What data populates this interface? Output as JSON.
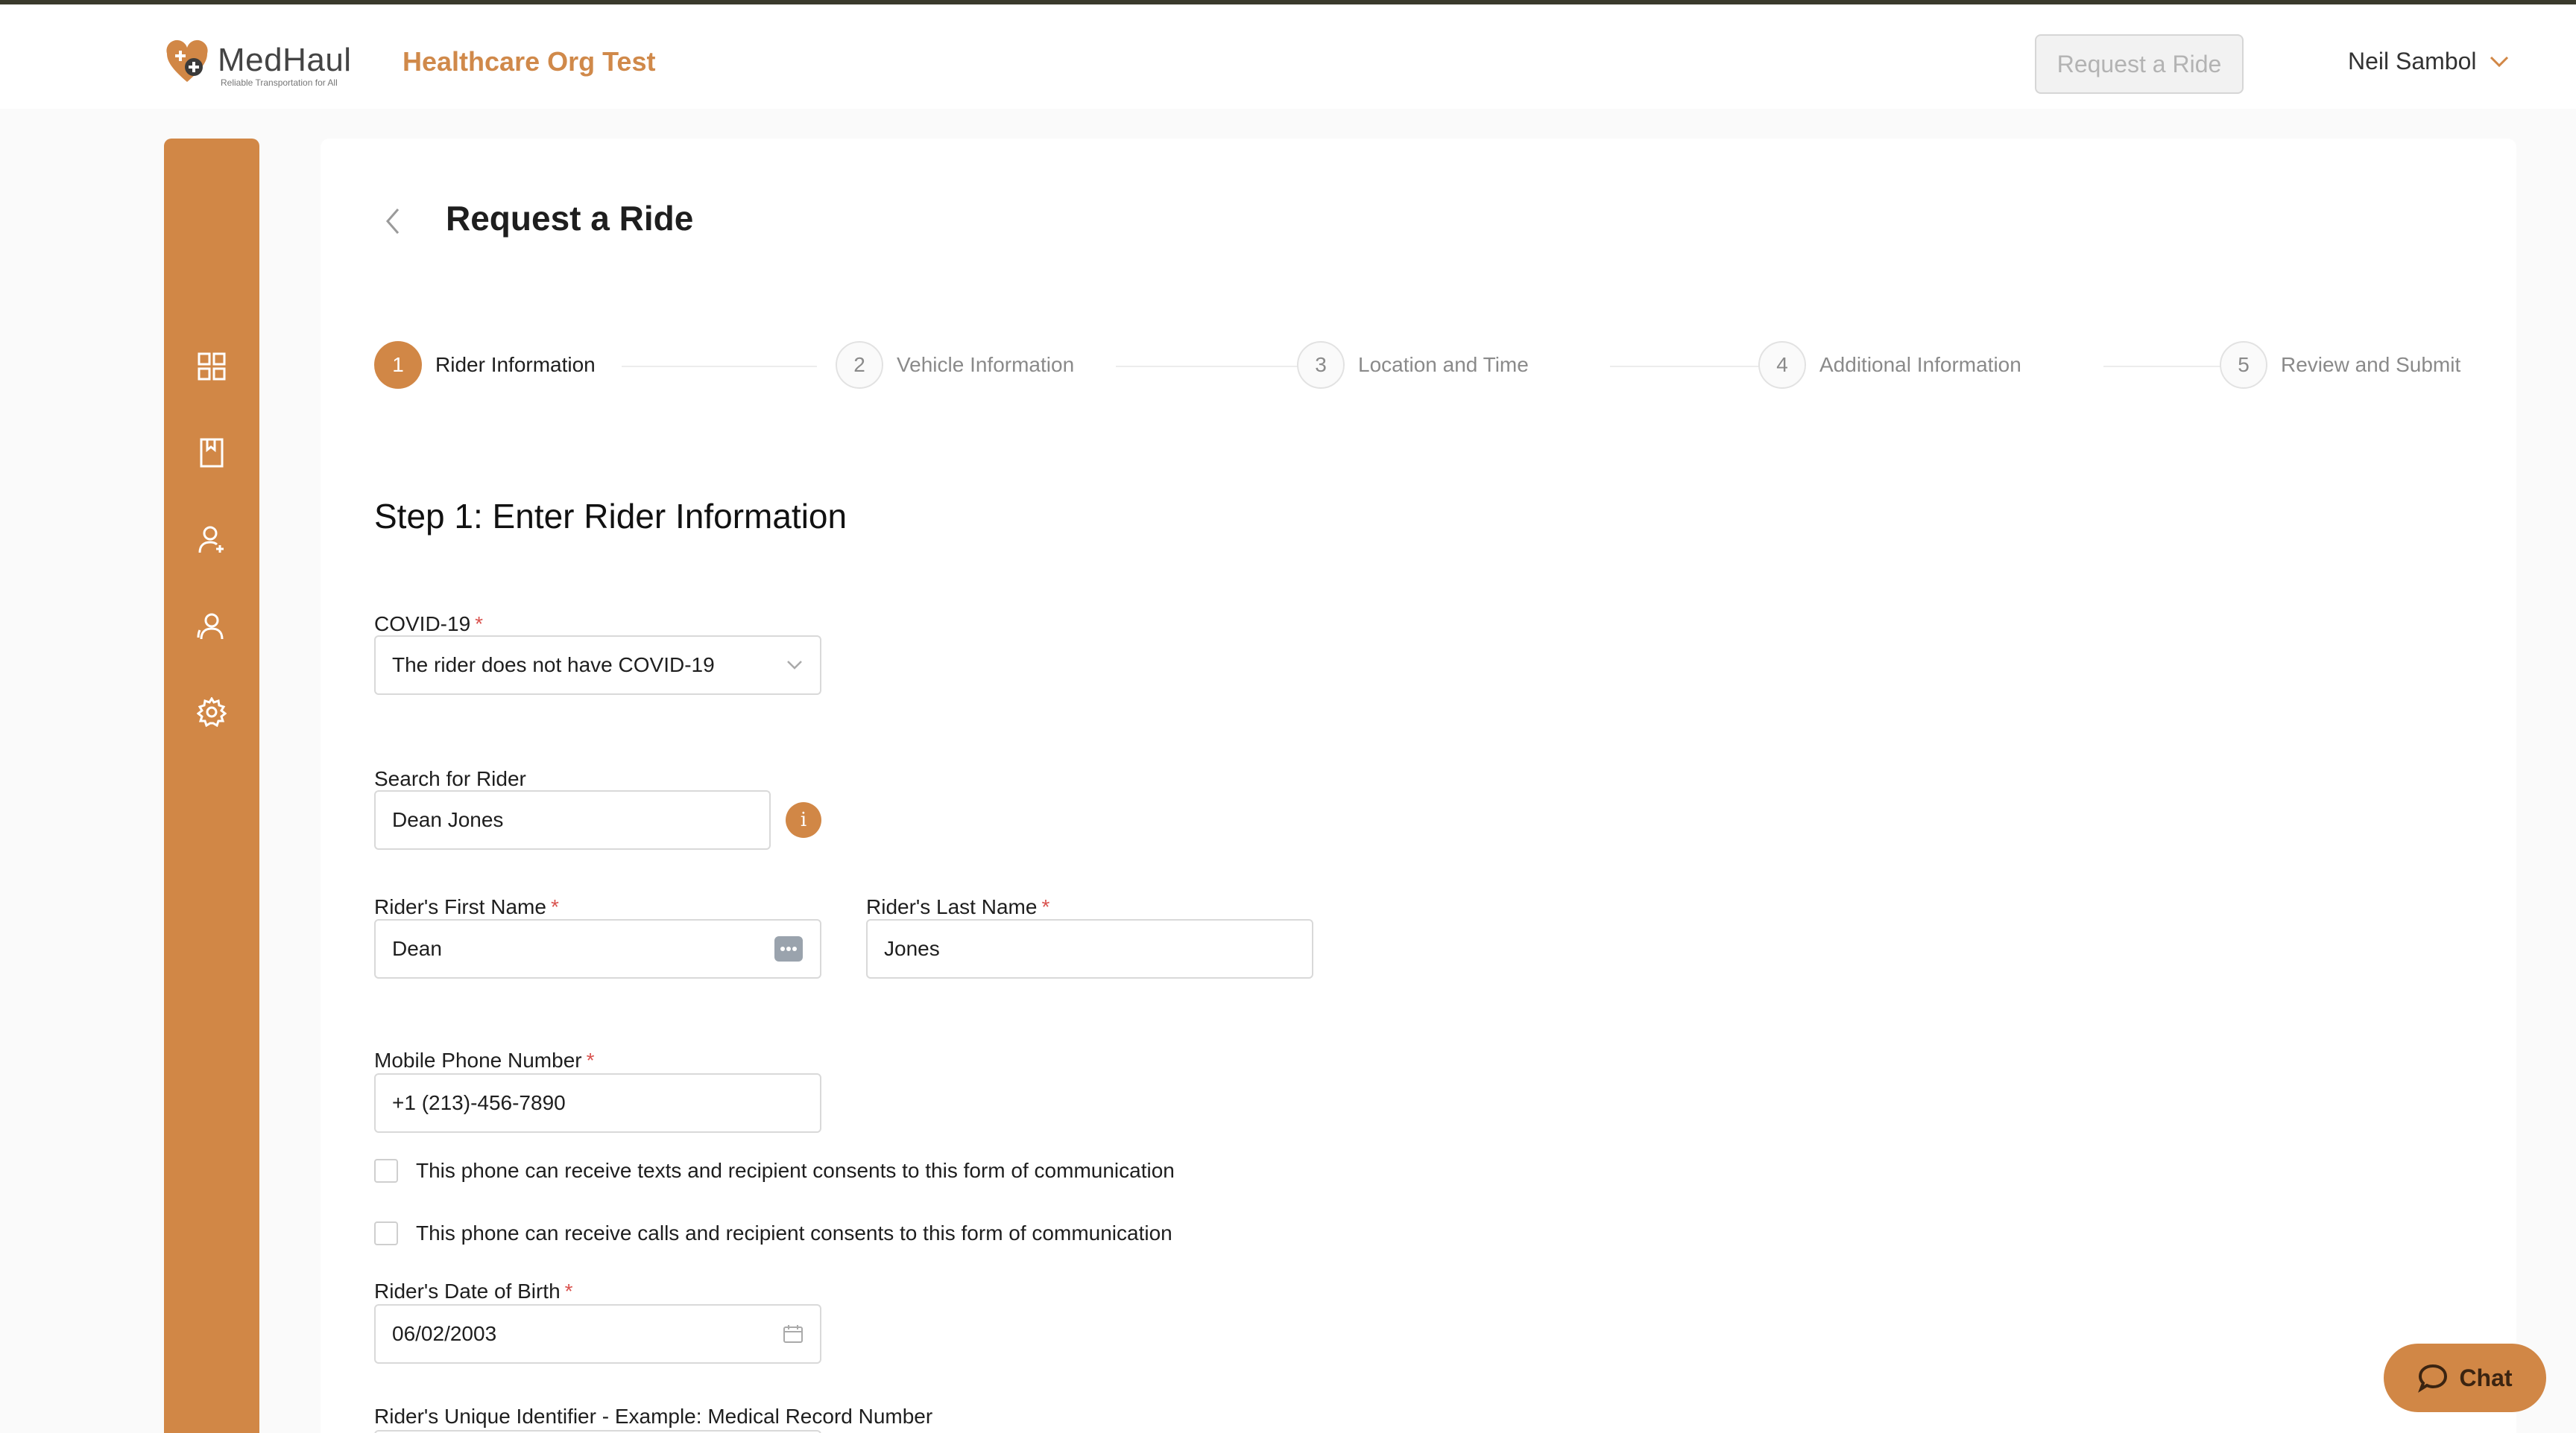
{
  "header": {
    "logo_text": "MedHaul",
    "logo_tagline": "Reliable Transportation for All",
    "org_name": "Healthcare Org Test",
    "request_button_label": "Request a Ride",
    "user_name": "Neil Sambol"
  },
  "sidebar": {
    "items": [
      {
        "icon": "dashboard-grid-icon"
      },
      {
        "icon": "bookmark-icon"
      },
      {
        "icon": "add-user-icon"
      },
      {
        "icon": "users-icon"
      },
      {
        "icon": "gear-icon"
      }
    ],
    "accent_color": "#d18746"
  },
  "page": {
    "title": "Request a Ride"
  },
  "stepper": {
    "steps": [
      {
        "number": "1",
        "label": "Rider Information",
        "active": true
      },
      {
        "number": "2",
        "label": "Vehicle Information",
        "active": false
      },
      {
        "number": "3",
        "label": "Location and Time",
        "active": false
      },
      {
        "number": "4",
        "label": "Additional Information",
        "active": false
      },
      {
        "number": "5",
        "label": "Review and Submit",
        "active": false
      }
    ]
  },
  "form": {
    "section_title": "Step 1: Enter Rider Information",
    "covid": {
      "label": "COVID-19",
      "required_mark": "*",
      "value": "The rider does not have COVID-19"
    },
    "search": {
      "label": "Search for Rider",
      "value": "Dean Jones",
      "info_glyph": "i"
    },
    "first_name": {
      "label": "Rider's First Name",
      "required_mark": "*",
      "value": "Dean"
    },
    "last_name": {
      "label": "Rider's Last Name",
      "required_mark": "*",
      "value": "Jones"
    },
    "mobile": {
      "label": "Mobile Phone Number",
      "required_mark": "*",
      "value": "+1 (213)-456-7890"
    },
    "texts_consent": {
      "label": "This phone can receive texts and recipient consents to this form of communication",
      "checked": false
    },
    "calls_consent": {
      "label": "This phone can receive calls and recipient consents to this form of communication",
      "checked": false
    },
    "dob": {
      "label": "Rider's Date of Birth",
      "required_mark": "*",
      "value": "06/02/2003"
    },
    "unique_id": {
      "label": "Rider's Unique Identifier - Example: Medical Record Number"
    }
  },
  "chat": {
    "label": "Chat"
  }
}
